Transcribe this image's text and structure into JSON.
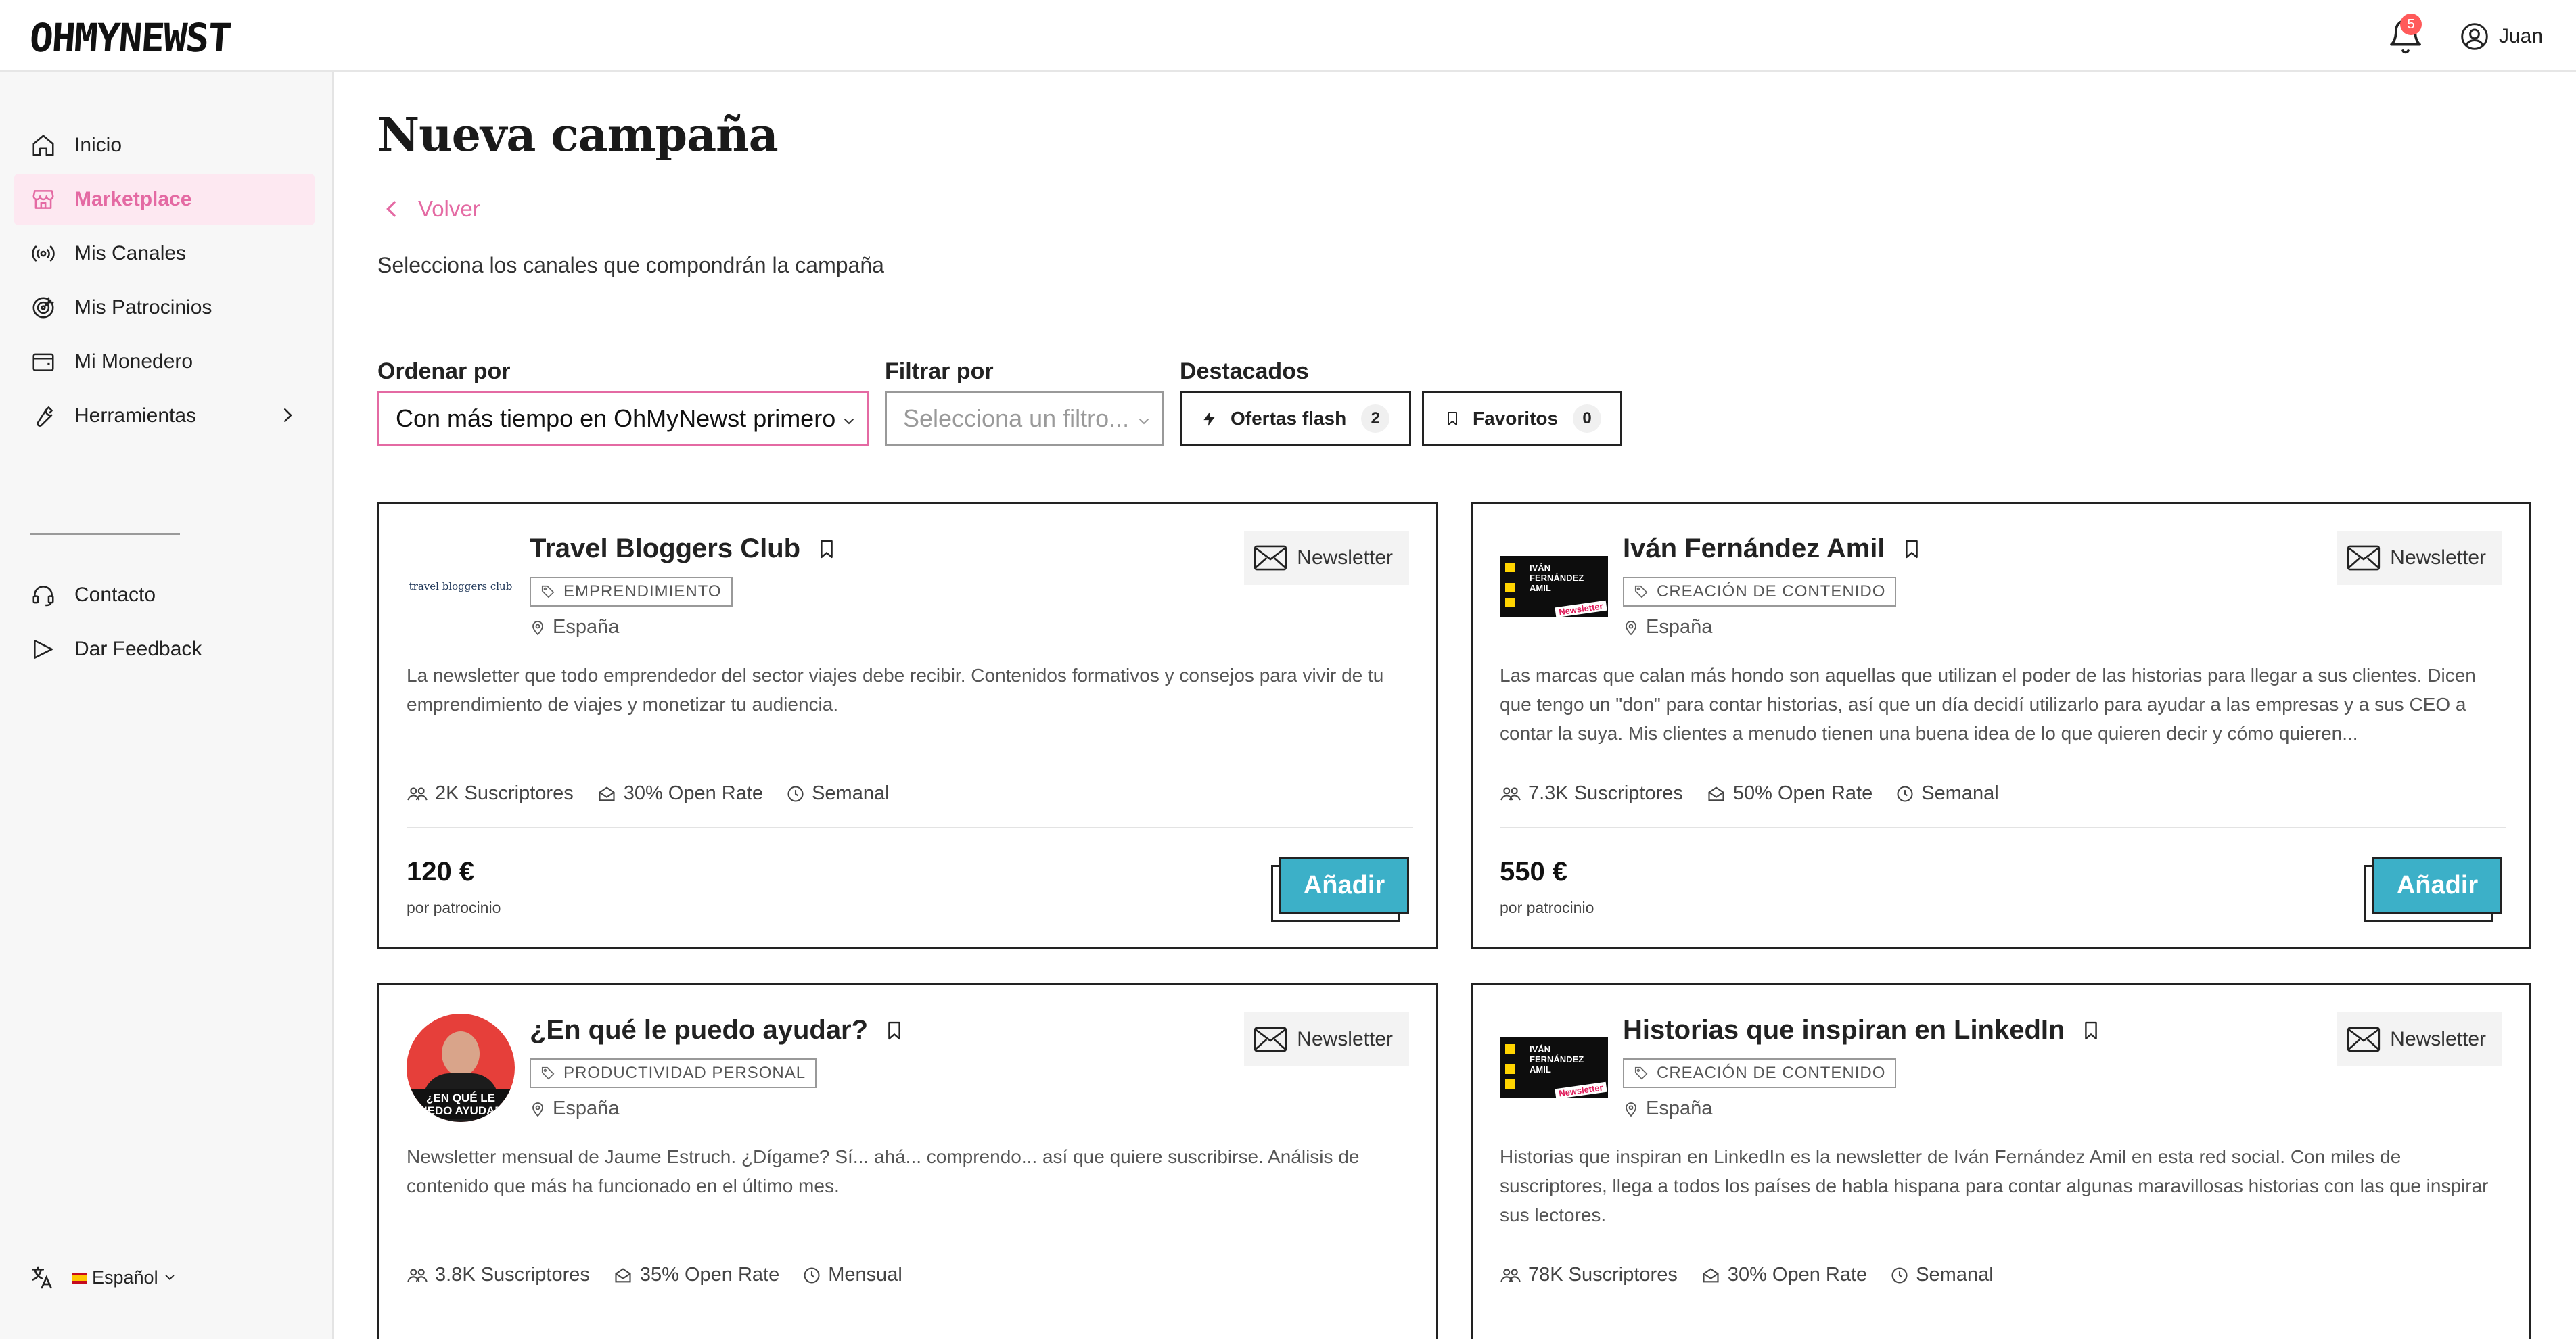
{
  "header": {
    "logo_text": "OHMYNEWST",
    "notifications_count": "5",
    "user_name": "Juan"
  },
  "sidebar": {
    "items": [
      {
        "label": "Inicio",
        "icon": "home-icon"
      },
      {
        "label": "Marketplace",
        "icon": "store-icon",
        "active": true
      },
      {
        "label": "Mis Canales",
        "icon": "broadcast-icon"
      },
      {
        "label": "Mis Patrocinios",
        "icon": "target-icon"
      },
      {
        "label": "Mi Monedero",
        "icon": "wallet-icon"
      },
      {
        "label": "Herramientas",
        "icon": "wrench-icon"
      }
    ],
    "secondary": [
      {
        "label": "Contacto",
        "icon": "headset-icon"
      },
      {
        "label": "Dar Feedback",
        "icon": "feedback-icon"
      }
    ],
    "language": "Español"
  },
  "main": {
    "title": "Nueva campaña",
    "back_label": "Volver",
    "subtitle": "Selecciona los canales que compondrán la campaña",
    "sort": {
      "label": "Ordenar por",
      "value": "Con más tiempo en OhMyNewst primero"
    },
    "filter": {
      "label": "Filtrar por",
      "placeholder": "Selecciona un filtro..."
    },
    "featured": {
      "label": "Destacados",
      "flash": {
        "label": "Ofertas flash",
        "count": "2"
      },
      "favorites": {
        "label": "Favoritos",
        "count": "0"
      }
    }
  },
  "cards": [
    {
      "name": "Travel Bloggers Club",
      "logo_text": "travel bloggers club",
      "category": "EMPRENDIMIENTO",
      "location": "España",
      "type": "Newsletter",
      "description": "La newsletter que todo emprendedor del sector viajes debe recibir. Contenidos formativos y consejos para vivir de tu emprendimiento de viajes y monetizar tu audiencia.",
      "subscribers": "2K Suscriptores",
      "open_rate": "30% Open Rate",
      "frequency": "Semanal",
      "price": "120 €",
      "price_note": "por patrocinio",
      "add_label": "Añadir"
    },
    {
      "name": "Iván Fernández Amil",
      "logo_text": "IVÁN FERNÁNDEZ AMIL",
      "logo_badge": "Newsletter",
      "category": "CREACIÓN DE CONTENIDO",
      "location": "España",
      "type": "Newsletter",
      "description": "Las marcas que calan más hondo son aquellas que utilizan el poder de las historias para llegar a sus clientes. Dicen que tengo un \"don\" para contar historias, así que un día decidí utilizarlo para ayudar a las empresas y a sus CEO a contar la suya. Mis clientes a menudo tienen una buena idea de lo que quieren decir y cómo quieren...",
      "subscribers": "7.3K Suscriptores",
      "open_rate": "50% Open Rate",
      "frequency": "Semanal",
      "price": "550 €",
      "price_note": "por patrocinio",
      "add_label": "Añadir"
    },
    {
      "name": "¿En qué le puedo ayudar?",
      "logo_text": "¿EN QUÉ LE PUEDO AYUDAR?",
      "category": "PRODUCTIVIDAD PERSONAL",
      "location": "España",
      "type": "Newsletter",
      "description": "Newsletter mensual de Jaume Estruch. ¿Dígame? Sí... ahá... comprendo... así que quiere suscribirse. Análisis de contenido que más ha funcionado en el último mes.",
      "subscribers": "3.8K Suscriptores",
      "open_rate": "35% Open Rate",
      "frequency": "Mensual"
    },
    {
      "name": "Historias que inspiran en LinkedIn",
      "logo_text": "IVÁN FERNÁNDEZ AMIL",
      "logo_badge": "Newsletter",
      "category": "CREACIÓN DE CONTENIDO",
      "location": "España",
      "type": "Newsletter",
      "description": "Historias que inspiran en LinkedIn es la newsletter de Iván Fernández Amil en esta red social. Con miles de suscriptores, llega a todos los países de habla hispana para contar algunas maravillosas historias con las que inspirar sus lectores.",
      "subscribers": "78K Suscriptores",
      "open_rate": "30% Open Rate",
      "frequency": "Semanal"
    }
  ],
  "colors": {
    "accent_pink": "#e46aa3",
    "active_bg": "#fde8f1",
    "button_teal": "#3cb0c8",
    "badge_red": "#ff5a5a"
  }
}
